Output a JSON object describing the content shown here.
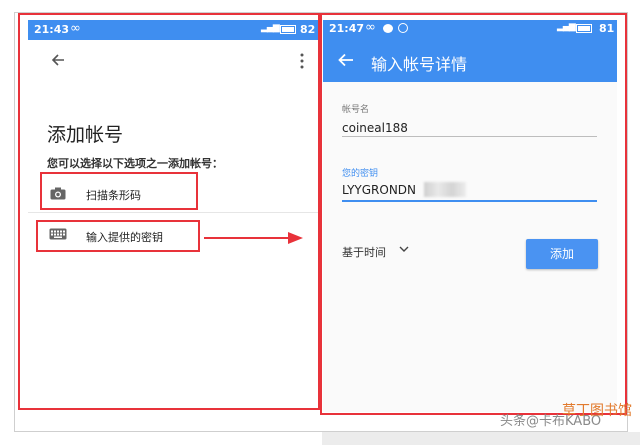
{
  "left_screen": {
    "status": {
      "time": "21:43",
      "infinity": "∞",
      "battery": "82"
    },
    "title": "添加帐号",
    "subtitle": "您可以选择以下选项之一添加帐号：",
    "options": [
      {
        "label": "扫描条形码",
        "icon": "camera-icon"
      },
      {
        "label": "输入提供的密钥",
        "icon": "keyboard-icon"
      }
    ]
  },
  "right_screen": {
    "status": {
      "time": "21:47",
      "infinity": "∞",
      "battery": "81"
    },
    "title": "输入帐号详情",
    "account_label": "帐号名",
    "account_value": "coineal188",
    "key_label": "您的密钥",
    "key_value": "LYYGRONDN",
    "type_selector": "基于时间",
    "add_label": "添加"
  },
  "colors": {
    "primary": "#3f8ef0",
    "highlight": "#e8323a"
  },
  "watermark": {
    "source": "头条@卡布KABO",
    "library": "草丁图书馆"
  }
}
